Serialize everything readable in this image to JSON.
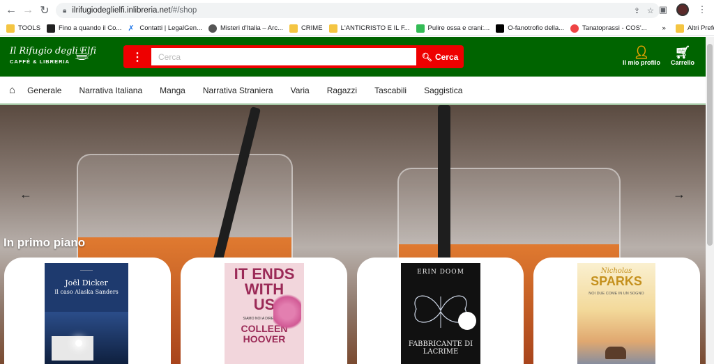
{
  "browser": {
    "url_host": "ilrifugiodeglielfi.inlibreria.net",
    "url_path": "/#/shop",
    "bookmarks": [
      "TOOLS",
      "Fino a quando il Co...",
      "Contatti | LegalGen...",
      "Misteri d'Italia – Arc...",
      "CRIME",
      "L'ANTICRISTO E IL F...",
      "Pulire ossa e crani:...",
      "O-fanotrofio della...",
      "Tanatoprassi - COS'...",
      "»",
      "Altri Preferiti"
    ]
  },
  "site": {
    "logo_line1": "Il Rifugio degli Elfi",
    "logo_line2": "CAFFÈ & LIBRERIA",
    "search_placeholder": "Cerca",
    "search_button": "Cerca",
    "profile_label": "Il mio profilo",
    "cart_label": "Carrello",
    "categories": [
      "Generale",
      "Narrativa Italiana",
      "Manga",
      "Narrativa Straniera",
      "Varia",
      "Ragazzi",
      "Tascabili",
      "Saggistica"
    ],
    "featured_heading": "In primo piano"
  },
  "books": [
    {
      "author": "Joël Dicker",
      "title": "Il caso Alaska Sanders",
      "bg": "#1e3a6e"
    },
    {
      "line1": "IT ENDS",
      "line2": "WITH",
      "line3": "US",
      "subtitle": "SIAMO NOI A DIRE BASTA",
      "author": "COLLEEN HOOVER",
      "bg": "#f2d6dc"
    },
    {
      "author": "ERIN DOOM",
      "title": "FABBRICANTE DI LACRIME",
      "bg": "#111"
    },
    {
      "author": "Nicholas",
      "author2": "SPARKS",
      "title": "NOI DUE COME IN UN SOGNO",
      "bg": "#f6e7b5"
    }
  ],
  "colors": {
    "header": "#006400",
    "search": "#e00000",
    "profile": "#f0a500"
  }
}
